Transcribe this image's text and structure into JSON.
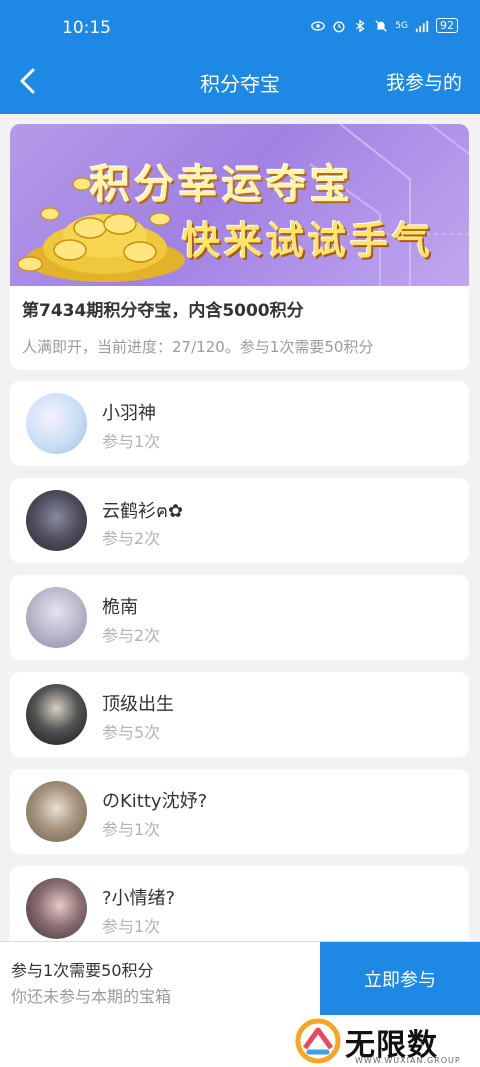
{
  "status_bar": {
    "time": "10:15",
    "network": "5G",
    "battery": "92",
    "icons": [
      "eye-icon",
      "alarm-icon",
      "bluetooth-icon",
      "mute-icon",
      "signal-icon",
      "battery-icon"
    ]
  },
  "nav": {
    "back_icon": "chevron-left-icon",
    "title": "积分夺宝",
    "right_label": "我参与的"
  },
  "banner": {
    "line1": "积分幸运夺宝",
    "line2": "快来试试手气"
  },
  "period": {
    "title": "第7434期积分夺宝，内含5000积分",
    "description": "人满即开，当前进度：27/120。参与1次需要50积分"
  },
  "participants": [
    {
      "name": "小羽神",
      "count": "参与1次",
      "avatar_color": "#c9dff5"
    },
    {
      "name": "云鹤衫ฅ✿",
      "count": "参与2次",
      "avatar_color": "#4d4d5c"
    },
    {
      "name": "桅南",
      "count": "参与2次",
      "avatar_color": "#b9b7c9"
    },
    {
      "name": "顶级出生",
      "count": "参与5次",
      "avatar_color": "#2f2f2f"
    },
    {
      "name": "のKitty沈妤?",
      "count": "参与1次",
      "avatar_color": "#8a7a68"
    },
    {
      "name": "?小情绪?",
      "count": "参与1次",
      "avatar_color": "#6b5e62"
    }
  ],
  "footer": {
    "need_text": "参与1次需要50积分",
    "status_text": "你还未参与本期的宝箱",
    "button_label": "立即参与"
  },
  "watermark": {
    "brand": "无限数码",
    "url": "WWW.WUXIAN.GROUP"
  },
  "colors": {
    "primary": "#1e88e5",
    "page_bg": "#f2f2f2",
    "muted_text": "#9b9b9b"
  }
}
